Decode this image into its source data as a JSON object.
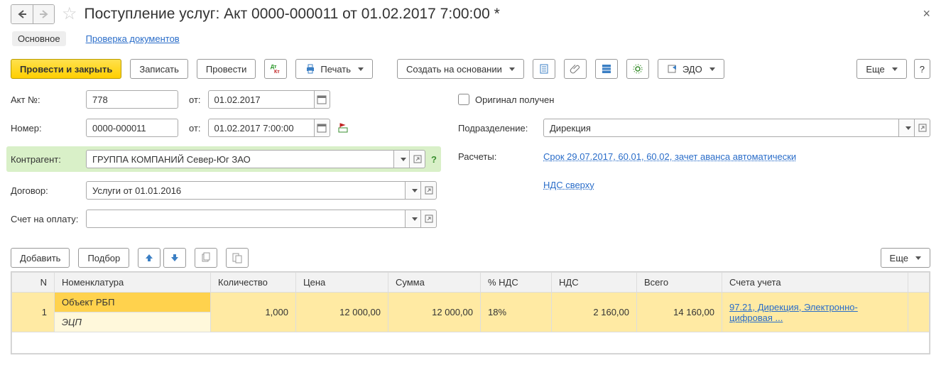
{
  "title": "Поступление услуг: Акт 0000-000011 от 01.02.2017 7:00:00 *",
  "tabs": {
    "main": "Основное",
    "check": "Проверка документов"
  },
  "toolbar": {
    "post_close": "Провести и закрыть",
    "save": "Записать",
    "post": "Провести",
    "print": "Печать",
    "create_based": "Создать на основании",
    "edo": "ЭДО",
    "more": "Еще",
    "help": "?"
  },
  "fields": {
    "act_no_label": "Акт №:",
    "act_no": "778",
    "from": "от:",
    "act_date": "01.02.2017",
    "number_label": "Номер:",
    "number": "0000-000011",
    "number_date": "01.02.2017  7:00:00",
    "contragent_label": "Контрагент:",
    "contragent": "ГРУППА КОМПАНИЙ Север-Юг ЗАО",
    "contract_label": "Договор:",
    "contract": "Услуги от 01.01.2016",
    "invoice_label": "Счет на оплату:",
    "invoice": "",
    "original_label": "Оригинал получен",
    "dept_label": "Подразделение:",
    "dept": "Дирекция",
    "calc_label": "Расчеты:",
    "calc_link": "Срок 29.07.2017, 60.01, 60.02, зачет аванса автоматически",
    "vat_link": "НДС сверху"
  },
  "table_toolbar": {
    "add": "Добавить",
    "select": "Подбор",
    "more": "Еще"
  },
  "table": {
    "headers": {
      "n": "N",
      "nom": "Номенклатура",
      "qty": "Количество",
      "price": "Цена",
      "sum": "Сумма",
      "vat_pct": "% НДС",
      "vat": "НДС",
      "total": "Всего",
      "accounts": "Счета учета"
    },
    "rows": [
      {
        "n": "1",
        "nom": "Объект РБП",
        "nom2": "ЭЦП",
        "qty": "1,000",
        "price": "12 000,00",
        "sum": "12 000,00",
        "vat_pct": "18%",
        "vat": "2 160,00",
        "total": "14 160,00",
        "accounts": "97.21, Дирекция, Электронно-цифровая ..."
      }
    ]
  }
}
